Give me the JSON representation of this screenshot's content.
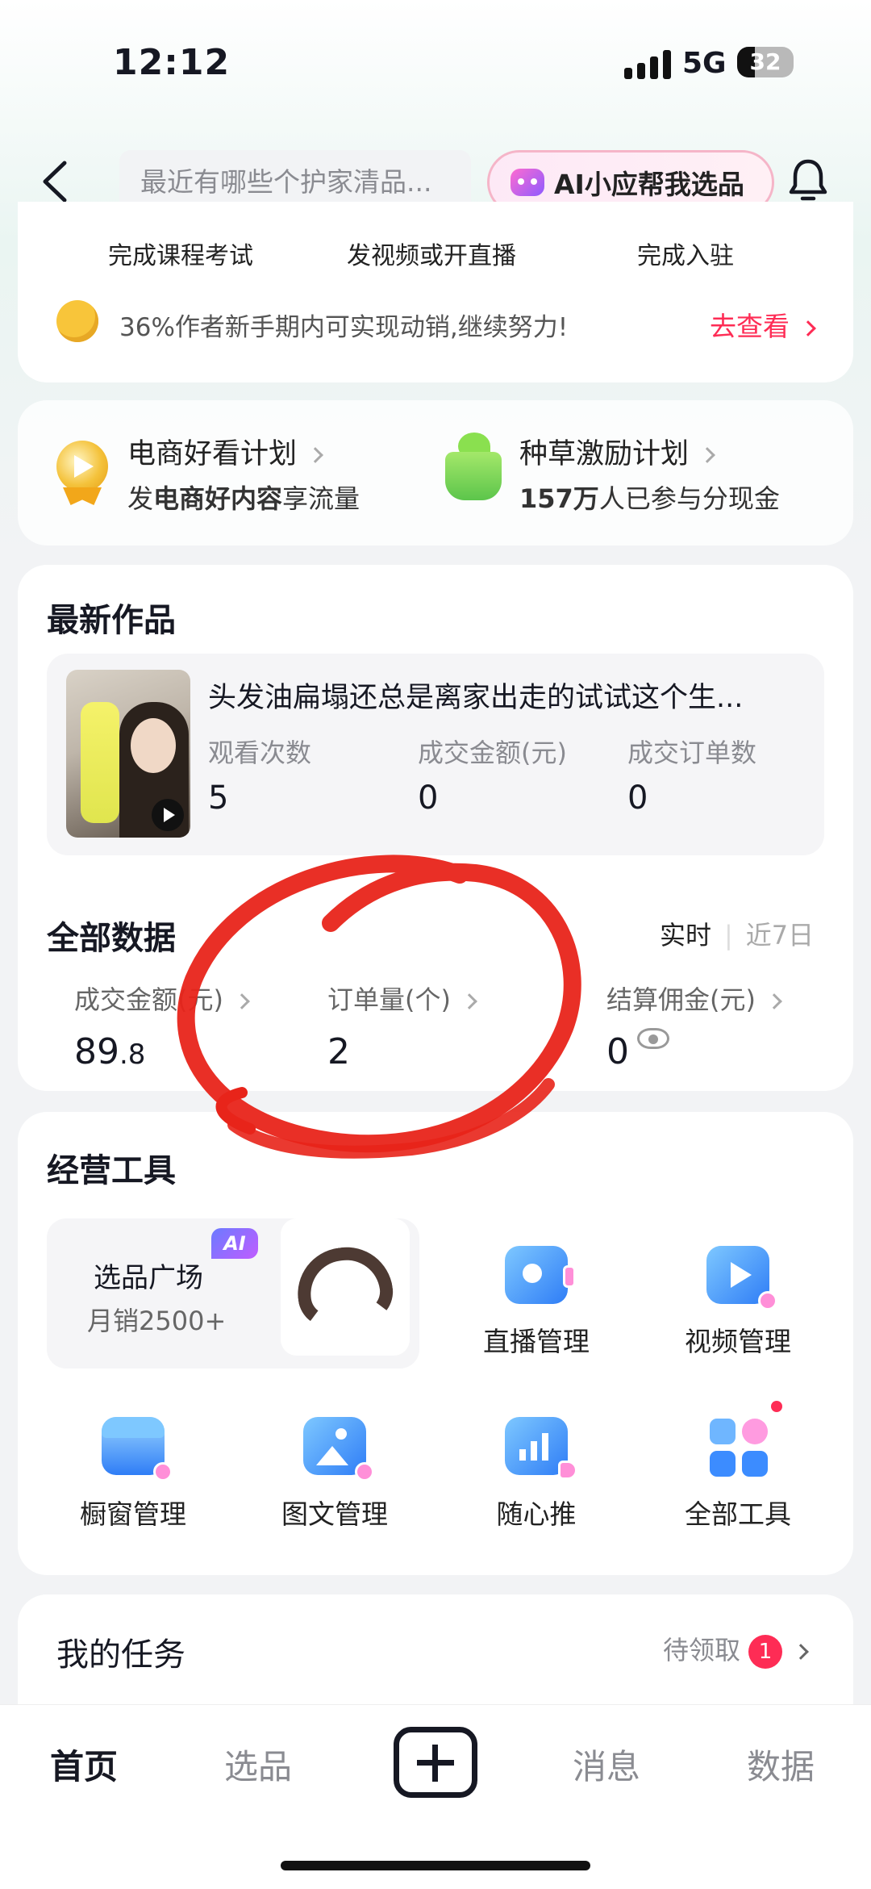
{
  "status": {
    "time": "12:12",
    "network": "5G",
    "battery": "32"
  },
  "header": {
    "search_placeholder": "最近有哪些个护家清品...",
    "ai_button": "AI小应帮我选品"
  },
  "onboarding": {
    "steps": [
      "完成课程考试",
      "发视频或开直播",
      "完成入驻"
    ],
    "tip": "36%作者新手期内可实现动销,继续努力!",
    "tip_link": "去查看"
  },
  "plans": [
    {
      "title": "电商好看计划",
      "sub_pre": "发",
      "sub_bold": "电商好内容",
      "sub_post": "享流量"
    },
    {
      "title": "种草激励计划",
      "sub_pre": "",
      "sub_bold": "157万",
      "sub_post": "人已参与分现金"
    }
  ],
  "latest": {
    "title": "最新作品",
    "work_title": "头发油扁塌还总是离家出走的试试这个生...",
    "stats": [
      {
        "label": "观看次数",
        "value": "5"
      },
      {
        "label": "成交金额(元)",
        "value": "0"
      },
      {
        "label": "成交订单数",
        "value": "0"
      }
    ]
  },
  "all_data": {
    "title": "全部数据",
    "toggle_on": "实时",
    "toggle_off": "近7日",
    "metrics": [
      {
        "label": "成交金额(元)",
        "value_int": "89",
        "value_dec": ".8"
      },
      {
        "label": "订单量(个)",
        "value": "2"
      },
      {
        "label": "结算佣金(元)",
        "value": "0"
      }
    ]
  },
  "tools": {
    "title": "经营工具",
    "pick_title": "选品广场",
    "pick_sub": "月销2500+",
    "pick_badge": "AI",
    "items": [
      "直播管理",
      "视频管理",
      "橱窗管理",
      "图文管理",
      "随心推",
      "全部工具"
    ]
  },
  "tasks": {
    "title": "我的任务",
    "pending": "待领取",
    "count": "1"
  },
  "tabbar": {
    "tabs": [
      "首页",
      "选品",
      "消息",
      "数据"
    ],
    "active": "首页"
  },
  "colors": {
    "accent": "#fe2c55",
    "annotation": "#e8241a"
  }
}
